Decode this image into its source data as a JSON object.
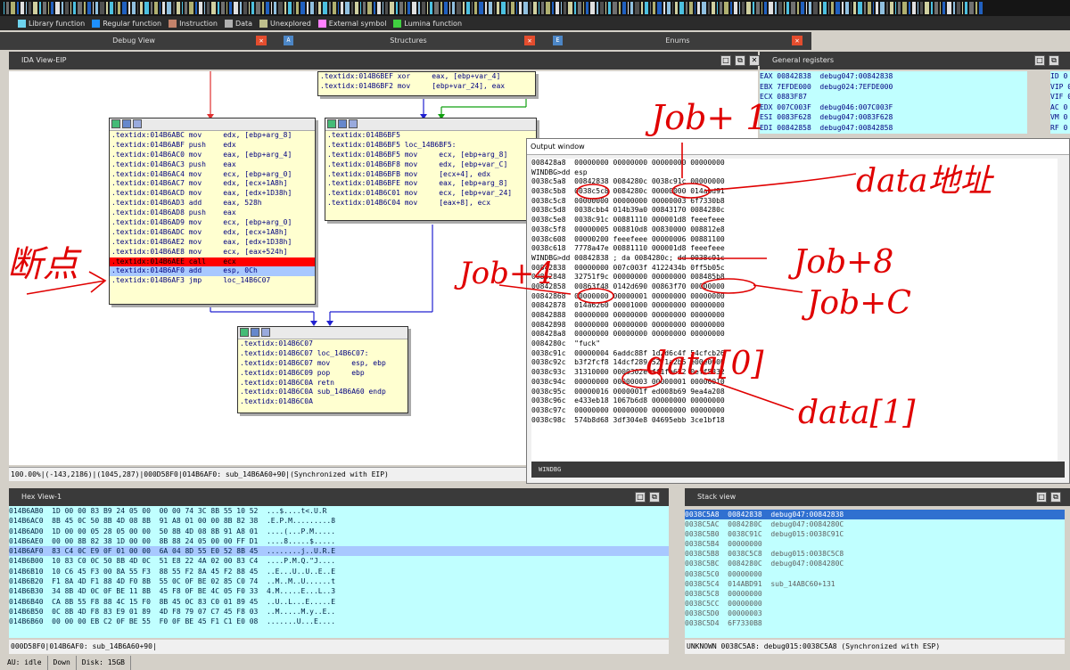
{
  "legend": [
    {
      "label": "Library function",
      "color": "#6dd3ee"
    },
    {
      "label": "Regular function",
      "color": "#1e90ff"
    },
    {
      "label": "Instruction",
      "color": "#c3826a"
    },
    {
      "label": "Data",
      "color": "#b0b0b0"
    },
    {
      "label": "Unexplored",
      "color": "#bfbf8c"
    },
    {
      "label": "External symbol",
      "color": "#ff80ff"
    },
    {
      "label": "Lumina function",
      "color": "#40d040"
    }
  ],
  "tabs": {
    "debug_view": "Debug View",
    "structures": "Structures",
    "enums": "Enums"
  },
  "ida_view": {
    "title": "IDA View-EIP"
  },
  "graph": {
    "top_node": [
      ".textidx:014B6BEF xor     eax, [ebp+var_4]",
      ".textidx:014B6BF2 mov     [ebp+var_24], eax"
    ],
    "left_node": [
      ".textidx:014B6ABC mov     edx, [ebp+arg_8]",
      ".textidx:014B6ABF push    edx",
      ".textidx:014B6AC0 mov     eax, [ebp+arg_4]",
      ".textidx:014B6AC3 push    eax",
      ".textidx:014B6AC4 mov     ecx, [ebp+arg_0]",
      ".textidx:014B6AC7 mov     edx, [ecx+1A8h]",
      ".textidx:014B6ACD mov     eax, [edx+1D38h]",
      ".textidx:014B6AD3 add     eax, 528h",
      ".textidx:014B6AD8 push    eax",
      ".textidx:014B6AD9 mov     ecx, [ebp+arg_0]",
      ".textidx:014B6ADC mov     edx, [ecx+1A8h]",
      ".textidx:014B6AE2 mov     eax, [edx+1D38h]",
      ".textidx:014B6AE8 mov     ecx, [eax+524h]",
      ".textidx:014B6AEE call    ecx",
      ".textidx:014B6AF0 add     esp, 0Ch",
      ".textidx:014B6AF3 jmp     loc_14B6C07"
    ],
    "right_node": [
      ".textidx:014B6BF5",
      ".textidx:014B6BF5 loc_14B6BF5:",
      ".textidx:014B6BF5 mov     ecx, [ebp+arg_8]",
      ".textidx:014B6BF8 mov     edx, [ebp+var_C]",
      ".textidx:014B6BFB mov     [ecx+4], edx",
      ".textidx:014B6BFE mov     eax, [ebp+arg_8]",
      ".textidx:014B6C01 mov     ecx, [ebp+var_24]",
      ".textidx:014B6C04 mov     [eax+8], ecx"
    ],
    "bottom_node": [
      ".textidx:014B6C07",
      ".textidx:014B6C07 loc_14B6C07:",
      ".textidx:014B6C07 mov     esp, ebp",
      ".textidx:014B6C09 pop     ebp",
      ".textidx:014B6C0A retn",
      ".textidx:014B6C0A sub_14B6A60 endp",
      ".textidx:014B6C0A"
    ]
  },
  "status": "100.00%|(-143,2186)|(1045,287)|000D58F0|014B6AF0: sub_14B6A60+90|(Synchronized with EIP)",
  "registers": {
    "title": "General registers",
    "rows": [
      "EAX 00842838  debug047:00842838",
      "EBX 7EFDE000  debug024:7EFDE000",
      "ECX 0883F87",
      "EDX 007C003F  debug046:007C003F",
      "ESI 0083F628  debug047:0083F628",
      "EDI 00842858  debug047:00842858"
    ],
    "flags": [
      "ID 0",
      "VIP 0",
      "VIF 0",
      "AC 0",
      "VM 0",
      "RF 0"
    ]
  },
  "output": {
    "title": "Output window",
    "lines": [
      "008428a8  00000000 00000000 00000000 00000000",
      "WINDBG>dd esp",
      "0038c5a8  00842838 0084280c 0038c91c 00000000",
      "0038c5b8  0038c5c8 0084280c 00000000 014abd91",
      "0038c5c8  00000000 00000000 00000003 6f7330b8",
      "0038c5d8  0038cbb4 014b39a0 00843170 0084280c",
      "0038c5e8  0038c91c 00881110 000001d8 feeefeee",
      "0038c5f8  00000005 008810d8 00830000 008812e8",
      "0038c608  00000200 feeefeee 00000006 00881100",
      "0038c618  7778a47e 00881110 000001d8 feeefeee",
      "WINDBG>dd 00842838 ; da 0084280c; dd 0038c91c",
      "00842838  00000000 007c003f 4122434b 0ff5b05c",
      "00842848  32751f9c 00000000 00000000 008485b8",
      "00842858  00863f48 0142d690 00863f70 00000000",
      "00842868  00000000 00000001 00000000 00000000",
      "00842878  014a6260 00001000 00000000 00000000",
      "00842888  00000000 00000000 00000000 00000000",
      "00842898  00000000 00000000 00000000 00000000",
      "008428a8  00000000 00000000 00000000 00000000",
      "0084280c  \"fuck\"",
      "0038c91c  00000004 6addc88f 1d2d6c4f 54cfcb26",
      "0038c92c  b3f2fcf8 14dcf289 5271a2b5 e00e000b",
      "0038c93c  31310000 0000302e ff1fe622 0eff5832",
      "0038c94c  00000000 00000003 00000001 00000010",
      "0038c95c  00000016 0000001f ed008b69 9ea4a208",
      "0038c96c  e433eb18 1067b6d8 00000000 00000000",
      "0038c97c  00000000 00000000 00000000 00000000",
      "0038c98c  574b8d68 3df304e8 04695ebb 3ce1bf18"
    ],
    "footer": "WINDBG"
  },
  "hex": {
    "title": "Hex View-1",
    "lines": [
      "014B6AB0  1D 00 00 83 B9 24 05 00  00 00 74 3C 8B 55 10 52  ...$....t<.U.R",
      "014B6AC0  8B 45 0C 50 8B 4D 08 8B  91 A8 01 00 00 8B 82 38  .E.P.M.........8",
      "014B6AD0  1D 00 00 05 28 05 00 00  50 8B 4D 08 8B 91 A8 01  ....(...P.M.....",
      "014B6AE0  00 00 8B 82 38 1D 00 00  8B 88 24 05 00 00 FF D1  ....8.....$.....",
      "014B6AF0  83 C4 0C E9 0F 01 00 00  6A 04 8D 55 E0 52 8B 45  ........j..U.R.E",
      "014B6B00  10 83 C0 0C 50 8B 4D 0C  51 E8 22 4A 02 00 83 C4  ....P.M.Q.\"J....",
      "014B6B10  10 C6 45 F3 00 8A 55 F3  88 55 F2 8A 45 F2 88 45  ..E...U..U..E..E",
      "014B6B20  F1 8A 4D F1 88 4D F0 8B  55 0C 0F BE 02 85 C0 74  ..M..M..U......t",
      "014B6B30  34 8B 4D 0C 0F BE 11 8B  45 F8 0F BE 4C 05 F0 33  4.M.....E...L..3",
      "014B6B40  CA 8B 55 F8 88 4C 15 F0  8B 45 0C 83 C0 01 89 45  ..U..L...E.....E",
      "014B6B50  0C 8B 4D F8 83 E9 01 89  4D F8 79 07 C7 45 F8 03  ..M.....M.y..E..",
      "014B6B60  00 00 00 EB C2 0F BE 55  F0 0F BE 45 F1 C1 E0 08  .......U...E...."
    ],
    "status": "000D58F0|014B6AF0: sub_14B6A60+90|"
  },
  "stack": {
    "title": "Stack view",
    "lines": [
      "0038C5A8  00842838  debug047:00842838",
      "0038C5AC  0084280C  debug047:0084280C",
      "0038C5B0  0038C91C  debug015:0038C91C",
      "0038C5B4  00000000",
      "0038C5B8  0038C5C8  debug015:0038C5C8",
      "0038C5BC  0084280C  debug047:0084280C",
      "0038C5C0  00000000",
      "0038C5C4  014ABD91  sub_14ABC60+131",
      "0038C5C8  00000000",
      "0038C5CC  00000000",
      "0038C5D0  00000003",
      "0038C5D4  6F7330B8"
    ],
    "status": "UNKNOWN 0038C5A8: debug015:0038C5A8 (Synchronized with ESP)"
  },
  "bottom": {
    "state": "AU: idle",
    "dir": "Down",
    "disk": "Disk: 15GB"
  },
  "annotations": {
    "job_t_1": "Job+ 1",
    "data_addr": "data地址",
    "breakpoint": "断点",
    "job_4": "Job+4",
    "job_8": "Job+8",
    "job_c": "Job+C",
    "data0": "data[0]",
    "data1": "data[1]"
  },
  "colors": {
    "hex_bg": "#c0ffff",
    "node_bg": "#ffffd0",
    "breakpoint": "#ff0000",
    "annotation": "#e00000"
  }
}
